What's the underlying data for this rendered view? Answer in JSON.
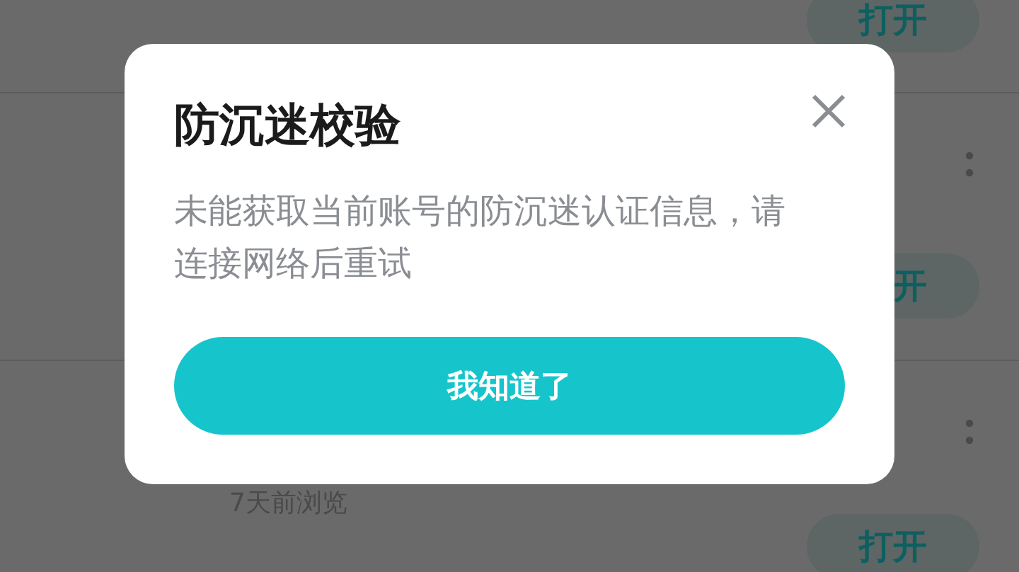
{
  "list": {
    "rows": [
      {
        "open_button": "打开",
        "has_more": false,
        "partly_covered": false
      },
      {
        "open_button": "开",
        "has_more": true,
        "partly_covered": true
      },
      {
        "subtitle": "7天前浏览",
        "open_button": "打开",
        "has_more": true,
        "partly_covered": false
      }
    ]
  },
  "dialog": {
    "title": "防沉迷校验",
    "message": "未能获取当前账号的防沉迷认证信息，请连接网络后重试",
    "button": "我知道了"
  }
}
